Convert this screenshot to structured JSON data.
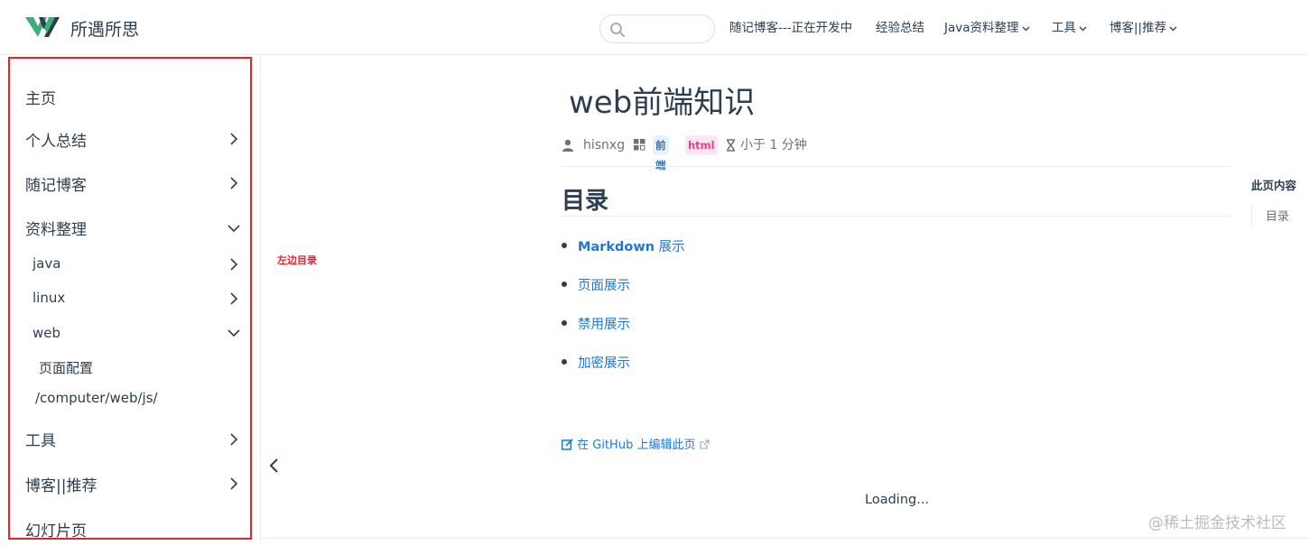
{
  "navbar": {
    "site_name": "所遇所思",
    "search": {
      "placeholder": "",
      "value": ""
    },
    "links": [
      {
        "label": "随记博客---正在开发中",
        "has_dropdown": false
      },
      {
        "label": "经验总结",
        "has_dropdown": false
      },
      {
        "label": "Java资料整理",
        "has_dropdown": true
      },
      {
        "label": "工具",
        "has_dropdown": true
      },
      {
        "label": "博客||推荐",
        "has_dropdown": true
      }
    ]
  },
  "sidebar": {
    "items": [
      {
        "label": "主页",
        "arrow": "none"
      },
      {
        "label": "个人总结",
        "arrow": "right"
      },
      {
        "label": "随记博客",
        "arrow": "right"
      },
      {
        "label": "资料整理",
        "arrow": "down"
      },
      {
        "label": "工具",
        "arrow": "right"
      },
      {
        "label": "博客||推荐",
        "arrow": "right"
      },
      {
        "label": "幻灯片页",
        "arrow": "none"
      }
    ],
    "sub_items": [
      {
        "label": "java",
        "arrow": "right"
      },
      {
        "label": "linux",
        "arrow": "right"
      },
      {
        "label": "web",
        "arrow": "down"
      }
    ],
    "leaf_items": [
      {
        "label": "页面配置"
      },
      {
        "label": "/computer/web/js/"
      }
    ]
  },
  "annotation": "左边目录",
  "article": {
    "title": "web前端知识",
    "author": "hisnxg",
    "tags": [
      {
        "label": "前端",
        "color": "#1f78d1",
        "bg": "#e8f1fc"
      },
      {
        "label": "html",
        "color": "#e83e8c",
        "bg": "#fde8f2"
      }
    ],
    "reading_time": "小于 1 分钟",
    "heading": "目录",
    "toc": [
      {
        "label_en": "Markdown",
        "label_zh": " 展示"
      },
      {
        "label_zh": "页面展示"
      },
      {
        "label_zh": "禁用展示"
      },
      {
        "label_zh": "加密展示"
      }
    ],
    "edit_link": "在 GitHub 上编辑此页",
    "loading": "Loading..."
  },
  "right_toc": {
    "title": "此页内容",
    "items": [
      "目录"
    ]
  },
  "watermark": "@稀土掘金技术社区",
  "colors": {
    "accent": "#1f78d1",
    "text": "#2c3e50",
    "annotation_red": "#e0262c",
    "logo_green": "#3eaf7c",
    "logo_dark": "#2c3e50"
  }
}
